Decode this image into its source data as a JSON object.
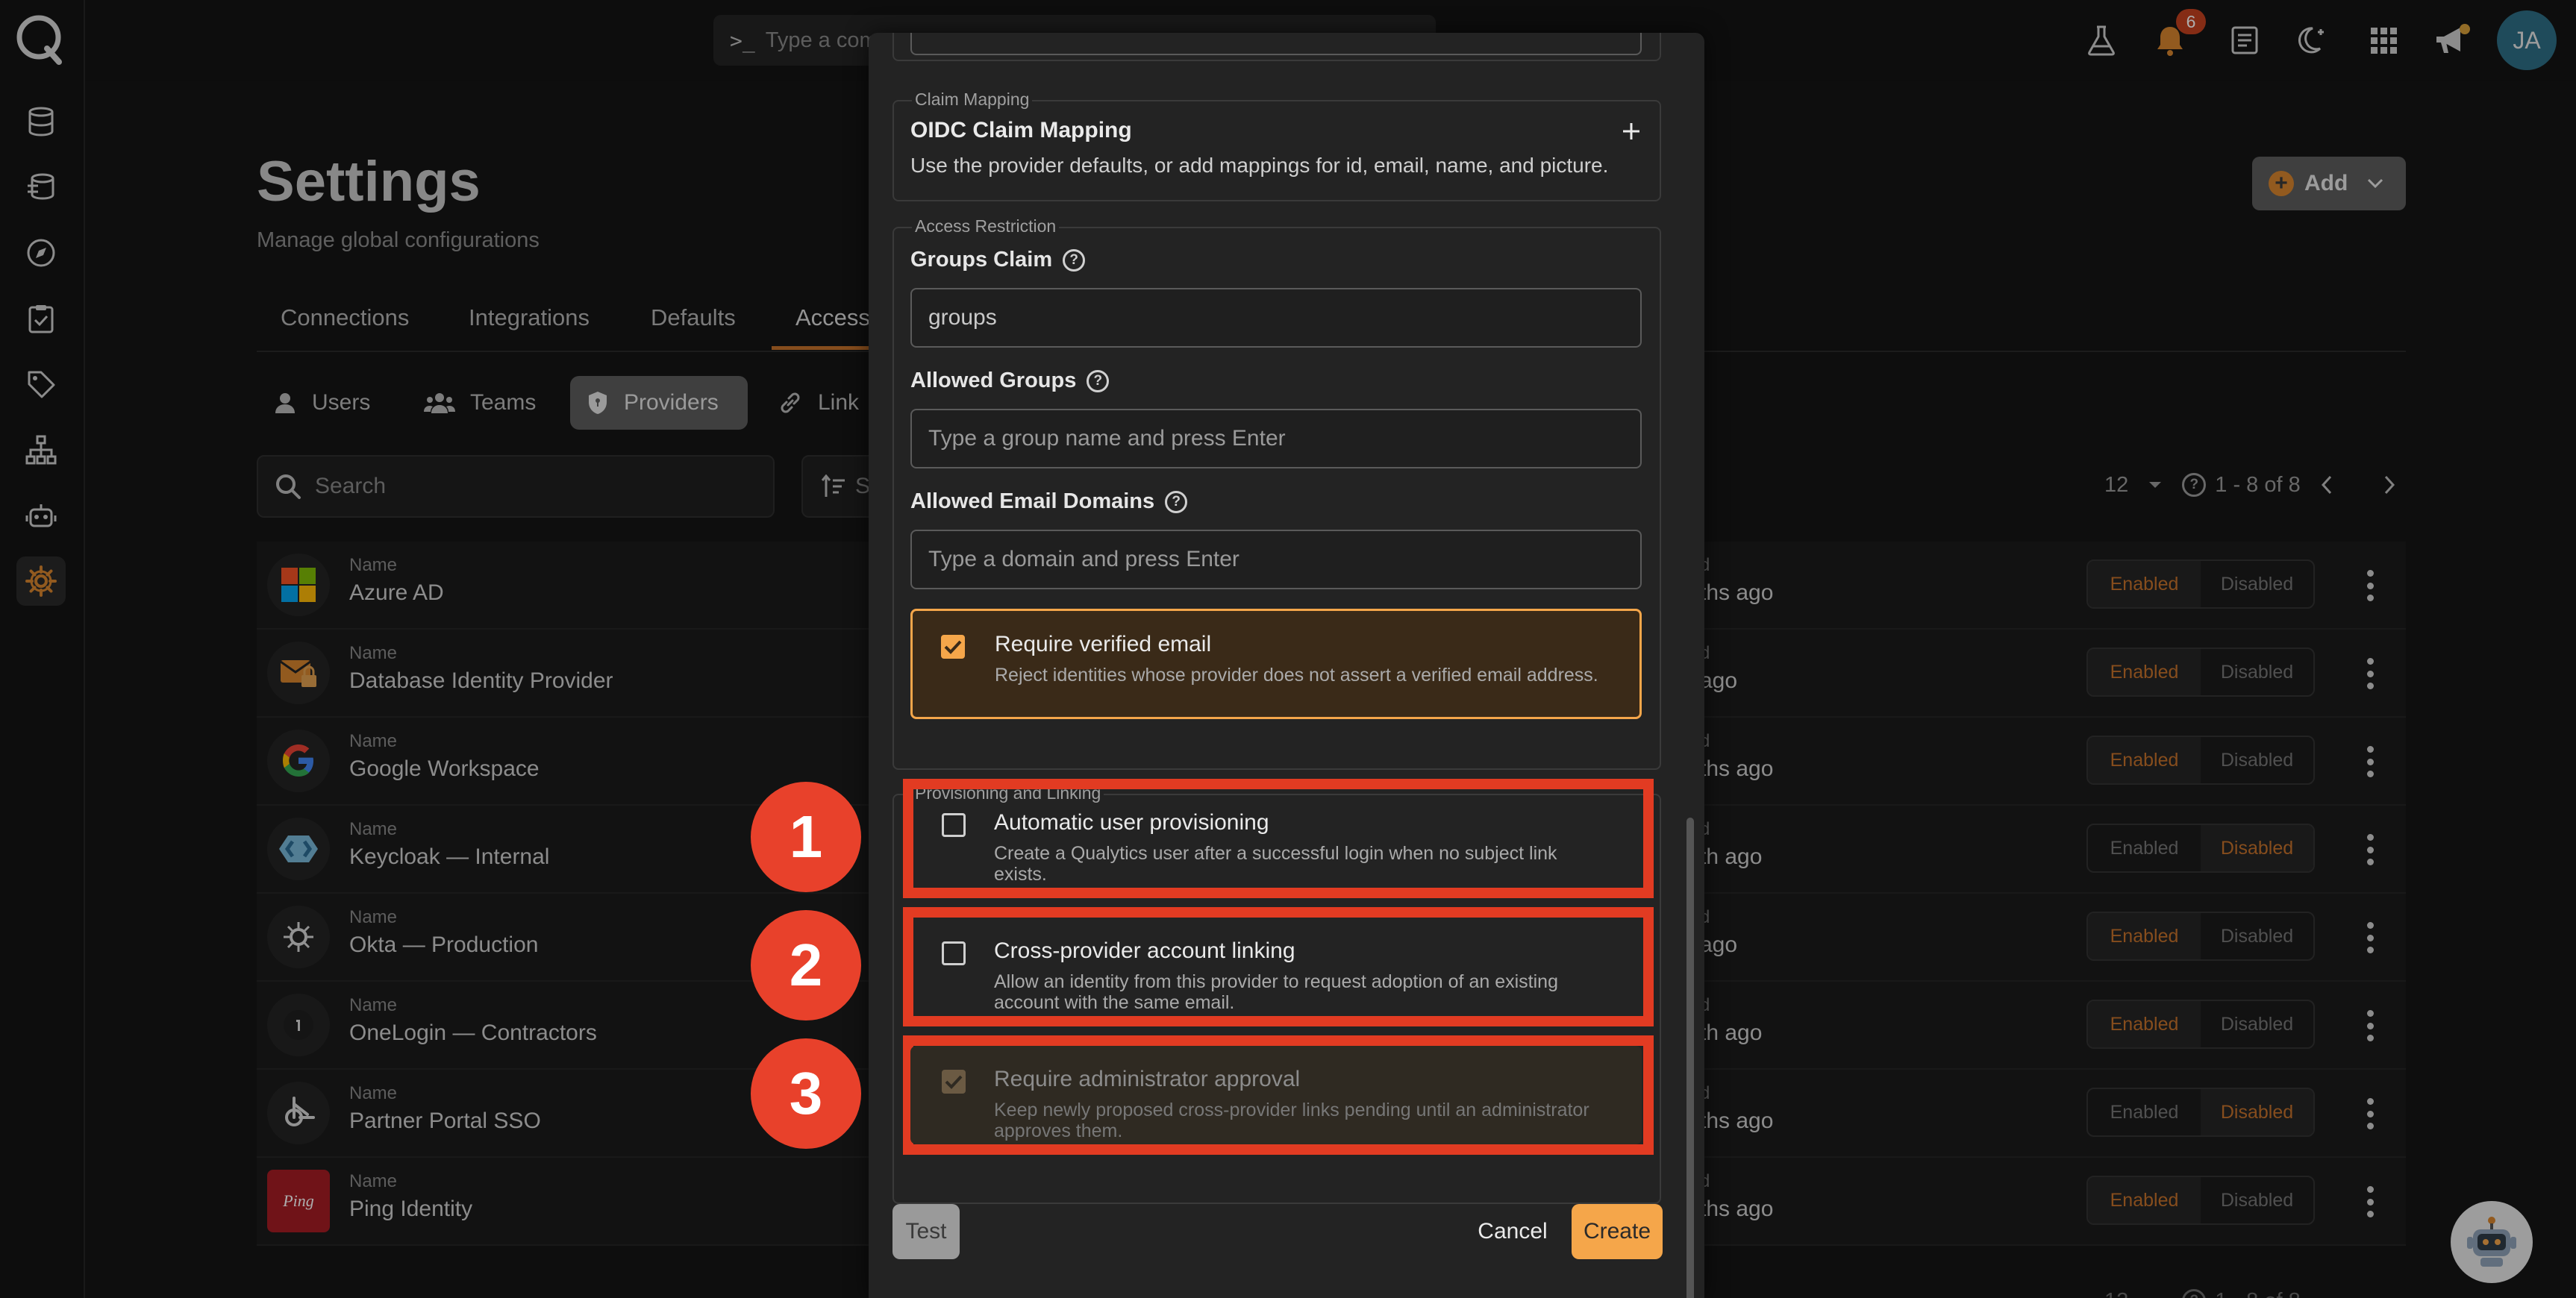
{
  "colors": {
    "accent": "#c6722c",
    "highlight": "#e23b22",
    "badge": "#e8412b",
    "create_bg": "#f5a64a"
  },
  "topbar": {
    "command_placeholder": "Type a comm",
    "notifications_count": "6",
    "avatar_initials": "JA"
  },
  "rail": {
    "icons": [
      "database-icon",
      "datasource-icon",
      "compass-icon",
      "clipboard-check-icon",
      "tag-icon",
      "hierarchy-icon",
      "robot-icon",
      "gear-icon"
    ]
  },
  "page": {
    "title": "Settings",
    "subtitle": "Manage global configurations",
    "add_label": "Add",
    "tabs": [
      "Connections",
      "Integrations",
      "Defaults",
      "Access"
    ],
    "subtabs": [
      "Users",
      "Teams",
      "Providers",
      "Link"
    ],
    "search_placeholder": "Search",
    "sort_label": "S",
    "page_size": "12",
    "range": "1 - 8 of 8"
  },
  "providers": {
    "column_label": "Name",
    "status_caption": "d",
    "enabled_label": "Enabled",
    "disabled_label": "Disabled",
    "rows": [
      {
        "name": "Azure AD",
        "ago": "ths ago",
        "enabled": true
      },
      {
        "name": "Database Identity Provider",
        "ago": "ago",
        "enabled": true
      },
      {
        "name": "Google Workspace",
        "ago": "ths ago",
        "enabled": true
      },
      {
        "name": "Keycloak — Internal",
        "ago": "th ago",
        "enabled": false
      },
      {
        "name": "Okta — Production",
        "ago": "ago",
        "enabled": true
      },
      {
        "name": "OneLogin — Contractors",
        "ago": "th ago",
        "enabled": true
      },
      {
        "name": "Partner Portal SSO",
        "ago": "ths ago",
        "enabled": false
      },
      {
        "name": "Ping Identity",
        "ago": "ths ago",
        "enabled": true
      }
    ]
  },
  "modal": {
    "claim_mapping": {
      "legend": "Claim Mapping",
      "title": "OIDC Claim Mapping",
      "description": "Use the provider defaults, or add mappings for id, email, name, and picture."
    },
    "access_restriction": {
      "legend": "Access Restriction",
      "groups_claim_label": "Groups Claim",
      "groups_claim_value": "groups",
      "allowed_groups_label": "Allowed Groups",
      "allowed_groups_placeholder": "Type a group name and press Enter",
      "allowed_domains_label": "Allowed Email Domains",
      "allowed_domains_placeholder": "Type a domain and press Enter",
      "verified_email_title": "Require verified email",
      "verified_email_desc": "Reject identities whose provider does not assert a verified email address.",
      "verified_email_checked": true
    },
    "provisioning": {
      "legend": "Provisioning and Linking",
      "options": [
        {
          "badge": "1",
          "title": "Automatic user provisioning",
          "desc": "Create a Qualytics user after a successful login when no subject link exists.",
          "checked": false,
          "disabled": false
        },
        {
          "badge": "2",
          "title": "Cross-provider account linking",
          "desc": "Allow an identity from this provider to request adoption of an existing account with the same email.",
          "checked": false,
          "disabled": false
        },
        {
          "badge": "3",
          "title": "Require administrator approval",
          "desc": "Keep newly proposed cross-provider links pending until an administrator approves them.",
          "checked": true,
          "disabled": true
        }
      ]
    },
    "buttons": {
      "test": "Test",
      "cancel": "Cancel",
      "create": "Create"
    }
  }
}
